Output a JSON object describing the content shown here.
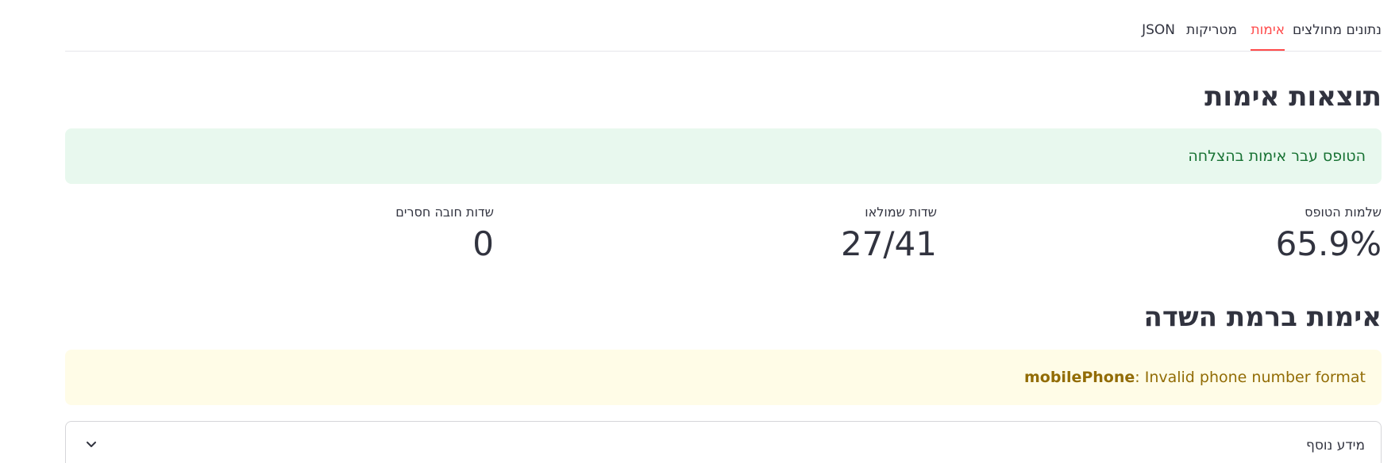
{
  "tabs": [
    {
      "label": "נתונים מחולצים",
      "active": false
    },
    {
      "label": "אימות",
      "active": true
    },
    {
      "label": "מטריקות",
      "active": false
    },
    {
      "label": "JSON",
      "active": false
    }
  ],
  "validation_section": {
    "title": "תוצאות אימות",
    "success_message": "הטופס עבר אימות בהצלחה"
  },
  "metrics": [
    {
      "label": "שלמות הטופס",
      "value": "65.9%"
    },
    {
      "label": "שדות שמולאו",
      "value": "27/41"
    },
    {
      "label": "שדות חובה חסרים",
      "value": "0"
    }
  ],
  "field_section": {
    "title": "אימות ברמת השדה",
    "warning": {
      "field": "mobilePhone",
      "separator": ": ",
      "message": "Invalid phone number format"
    }
  },
  "expander": {
    "label": "מידע נוסף",
    "icon": "chevron-down-icon"
  },
  "colors": {
    "accent": "#ff4b4b",
    "success_bg": "#e8f8ee",
    "success_text": "#177233",
    "warning_bg": "#fffce7",
    "warning_text": "#926c05"
  }
}
